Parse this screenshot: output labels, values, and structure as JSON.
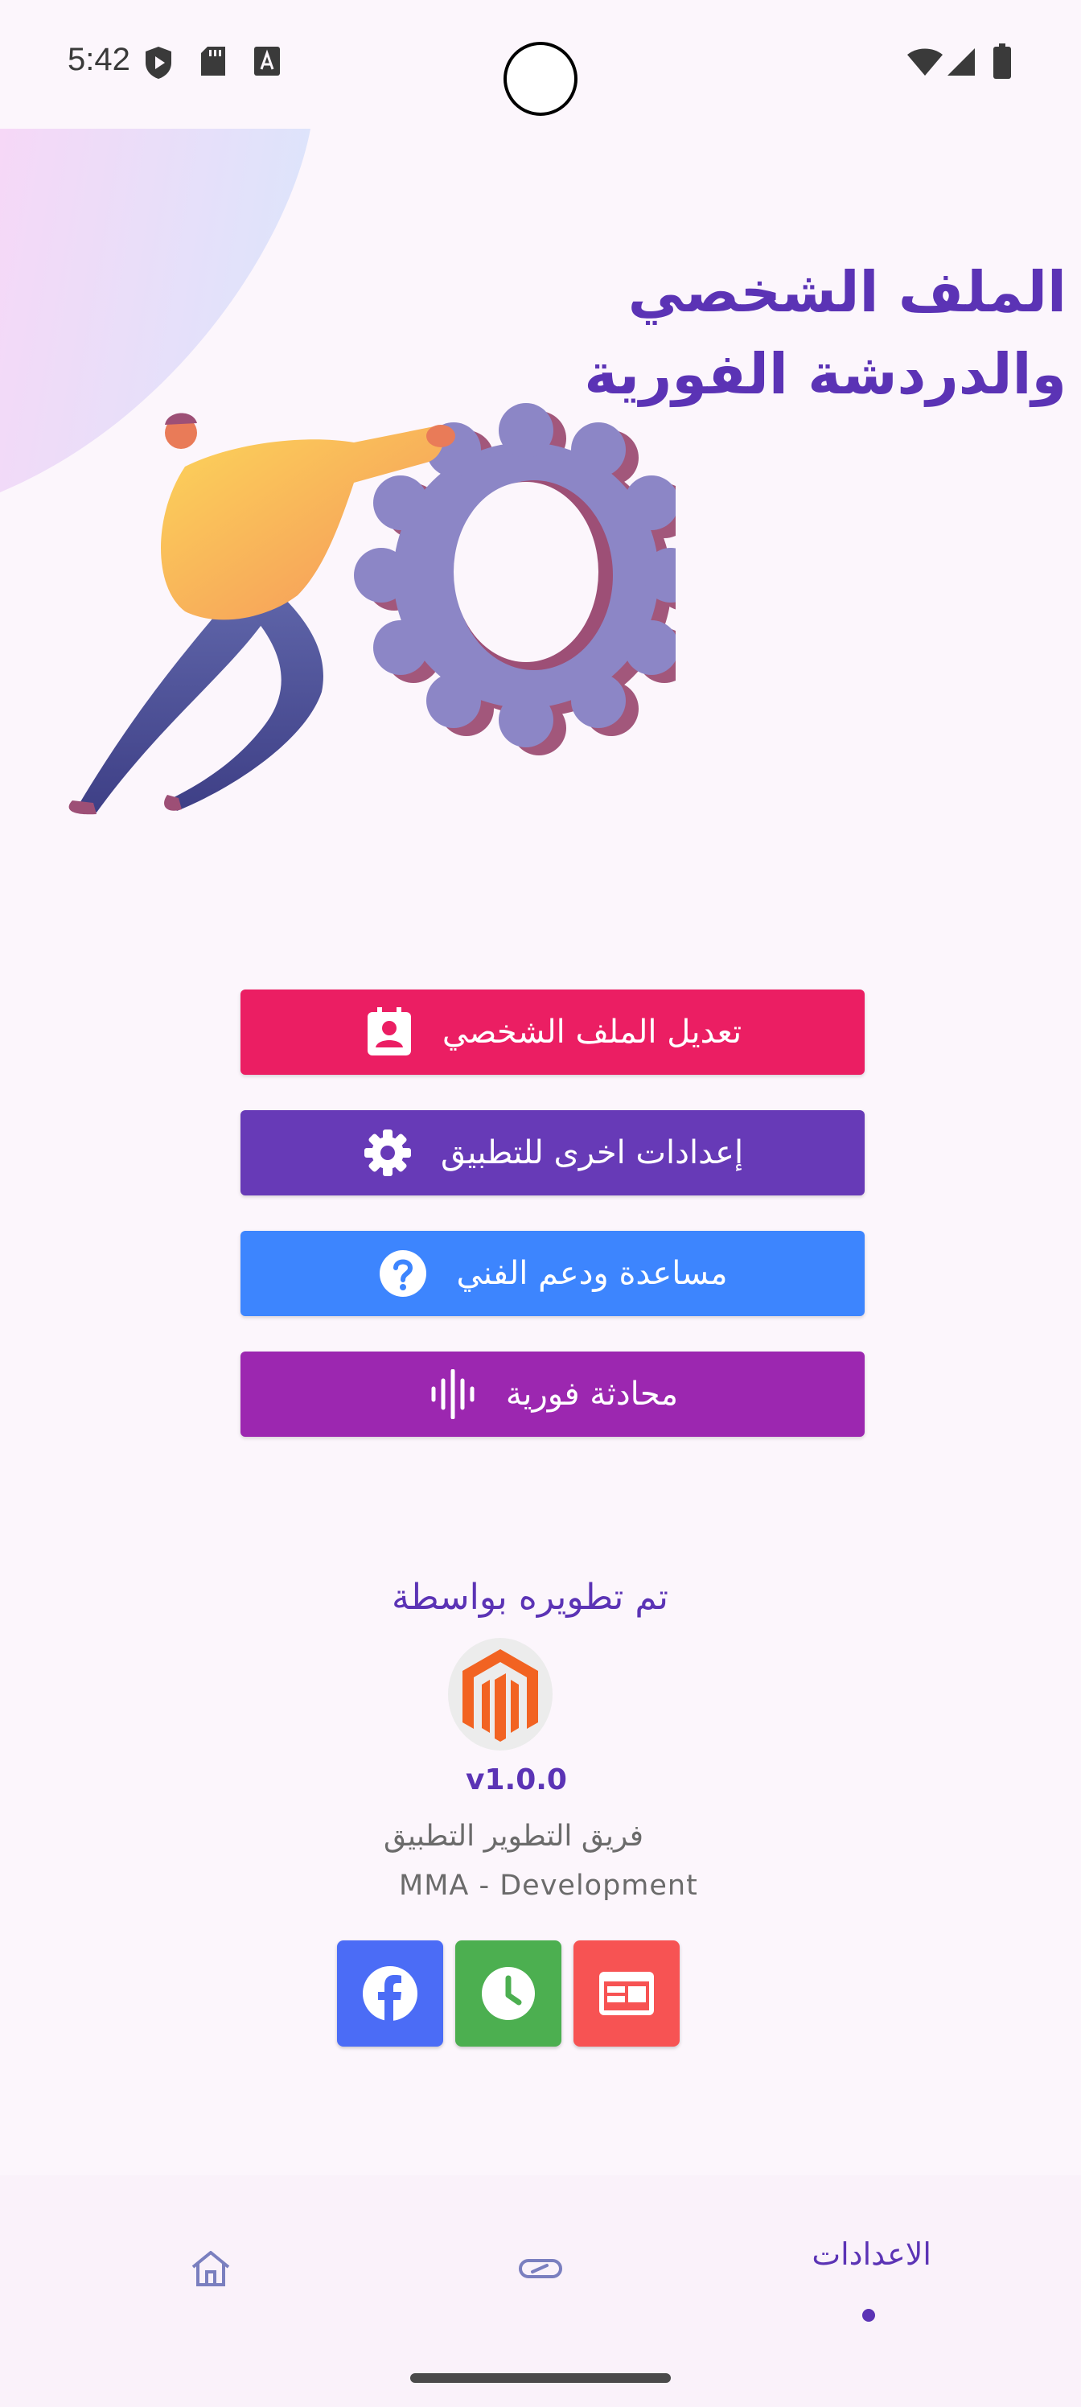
{
  "status_bar": {
    "time": "5:42",
    "icons": [
      "play-protect-icon",
      "sd-card-icon",
      "text-a-icon",
      "wifi-icon",
      "signal-icon",
      "battery-icon"
    ]
  },
  "header": {
    "title_line1": "الملف الشخصي",
    "title_line2": "والدردشة الفورية"
  },
  "actions": [
    {
      "label": "تعديل الملف الشخصي",
      "icon": "contact-card-icon",
      "color": "#eb1e63"
    },
    {
      "label": "إعدادات اخرى للتطبيق",
      "icon": "gear-icon",
      "color": "#673ab7"
    },
    {
      "label": "مساعدة ودعم الفني",
      "icon": "help-circle-icon",
      "color": "#3d85fe"
    },
    {
      "label": "محادثة فورية",
      "icon": "audio-wave-icon",
      "color": "#9c27b0"
    }
  ],
  "credits": {
    "title": "تم تطويره بواسطة",
    "logo_icon": "magento-logo-icon",
    "version": "v1.0.0",
    "team": "فريق التطوير التطبيق",
    "company": "MMA - Development"
  },
  "social": [
    {
      "icon": "facebook-icon",
      "color": "#4b6cf6"
    },
    {
      "icon": "clock-icon",
      "color": "#4caf50"
    },
    {
      "icon": "web-icon",
      "color": "#f75353"
    }
  ],
  "bottom_nav": {
    "active_label": "الاعدادات",
    "items": [
      "home-icon",
      "gamepad-icon",
      "settings-tab"
    ]
  },
  "colors": {
    "accent": "#5b33b5",
    "background": "#fcf6fc"
  }
}
